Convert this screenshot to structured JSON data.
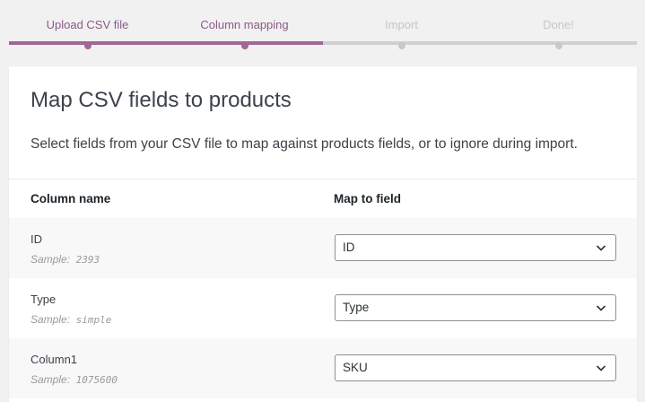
{
  "steps": [
    {
      "label": "Upload CSV file",
      "state": "done"
    },
    {
      "label": "Column mapping",
      "state": "active"
    },
    {
      "label": "Import",
      "state": "inactive"
    },
    {
      "label": "Done!",
      "state": "inactive"
    }
  ],
  "card": {
    "title": "Map CSV fields to products",
    "description": "Select fields from your CSV file to map against products fields, or to ignore during import."
  },
  "table": {
    "col_name_header": "Column name",
    "col_map_header": "Map to field",
    "sample_prefix": "Sample:",
    "rows": [
      {
        "name": "ID",
        "sample": "2393",
        "mapped": "ID"
      },
      {
        "name": "Type",
        "sample": "simple",
        "mapped": "Type"
      },
      {
        "name": "Column1",
        "sample": "1075600",
        "mapped": "SKU"
      }
    ]
  },
  "icons": {
    "select_arrow": "chevron-down-icon"
  },
  "colors": {
    "accent": "#a16696",
    "accent_text": "#8a5a86",
    "inactive": "#d0d0d0"
  }
}
